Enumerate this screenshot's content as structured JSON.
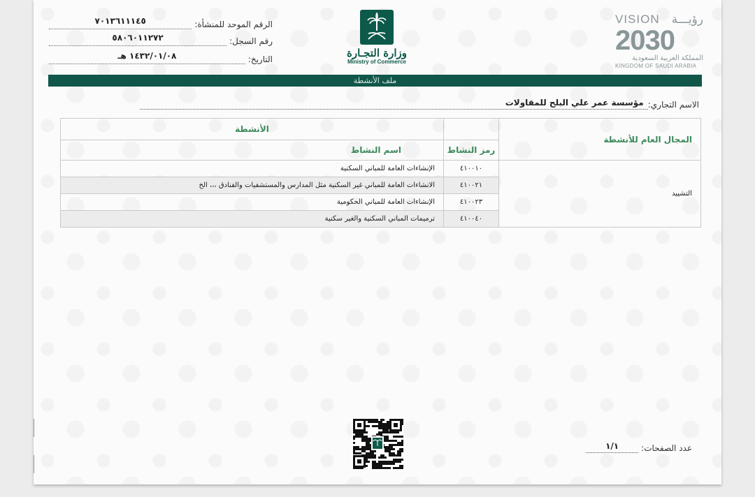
{
  "header": {
    "unified_number_label": "الرقم الموحد للمنشأة:",
    "unified_number_value": "٧٠١٣٦١١١٤٥",
    "registration_label": "رقم السجل:",
    "registration_value": "٥٨٠٦٠١١٢٧٢",
    "date_label": "التاريخ:",
    "date_value": "١٤٣٢/٠١/٠٨ هـ"
  },
  "ministry": {
    "name_ar": "وزارة التجـارة",
    "name_en": "Ministry of Commerce"
  },
  "vision": {
    "vision_en": "VISION",
    "vision_ar": "رؤيـــة",
    "year": "2030",
    "kingdom_ar": "المملكة العربية السعودية",
    "kingdom_en": "KINGDOM OF SAUDI ARABIA"
  },
  "bar_title": "ملف الأنشطة",
  "trade_name": {
    "label": "الاسم التجاري:",
    "value": "مؤسسة عمر علي البلح للمقاولات"
  },
  "table": {
    "general_field_header": "المجال العام للأنشطة",
    "activities_header": "الأنشطة",
    "code_header": "رمز النشاط",
    "name_header": "اسم النشاط",
    "general_field_value": "التشييد",
    "rows": [
      {
        "code": "٤١٠٠١٠",
        "name": "الإنشاءات العامة للمباني السكنية"
      },
      {
        "code": "٤١٠٠٢١",
        "name": "الانشاءات العامة للمباني غير السكنية مثل المدارس والمستشفيات والفنادق ،،، الخ"
      },
      {
        "code": "٤١٠٠٢٣",
        "name": "الإنشاءات العامة للمباني الحكومية"
      },
      {
        "code": "٤١٠٠٤٠",
        "name": "ترميمات المباني السكنية والغير سكنية"
      }
    ]
  },
  "footer": {
    "pages_label": "عدد الصفحات:",
    "pages_value": "١/١"
  },
  "colors": {
    "brand_green": "#10574a",
    "header_text_green": "#3d8a5d"
  }
}
